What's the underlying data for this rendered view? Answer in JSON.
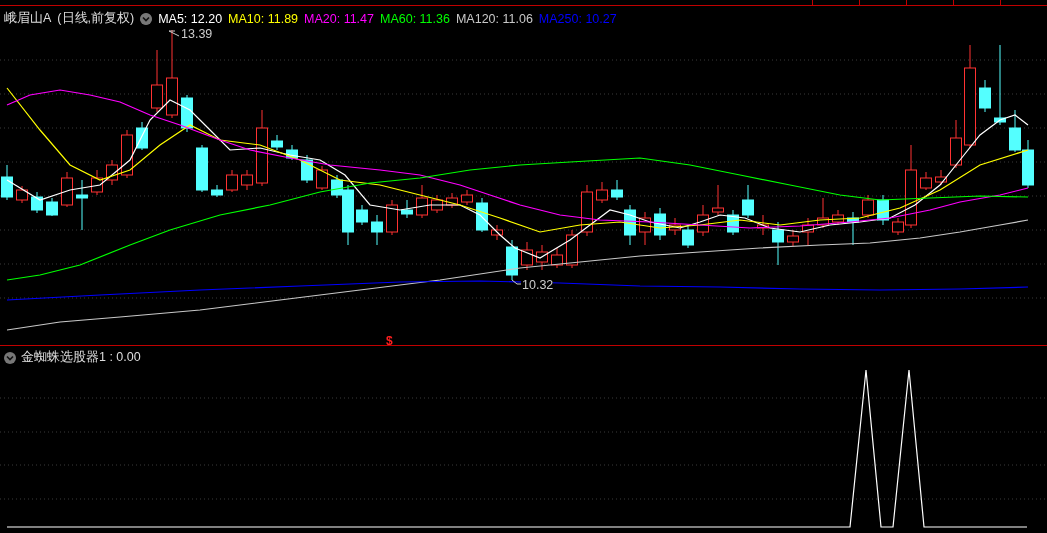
{
  "chart": {
    "title": "峨眉山A",
    "period": "(日线,前复权)",
    "moving_averages": [
      {
        "label": "MA5: 12.20",
        "color": "#ffffff"
      },
      {
        "label": "MA10: 11.89",
        "color": "#ffff00"
      },
      {
        "label": "MA20: 11.47",
        "color": "#ff00ff"
      },
      {
        "label": "MA60: 11.36",
        "color": "#00ff00"
      },
      {
        "label": "MA120: 11.06",
        "color": "#c8c8c8"
      },
      {
        "label": "MA250: 10.27",
        "color": "#0000ff"
      }
    ],
    "high_label": "13.39",
    "low_label": "10.32",
    "marker": "$"
  },
  "indicator": {
    "label": "金蜘蛛选股器1 : 0.00"
  }
}
